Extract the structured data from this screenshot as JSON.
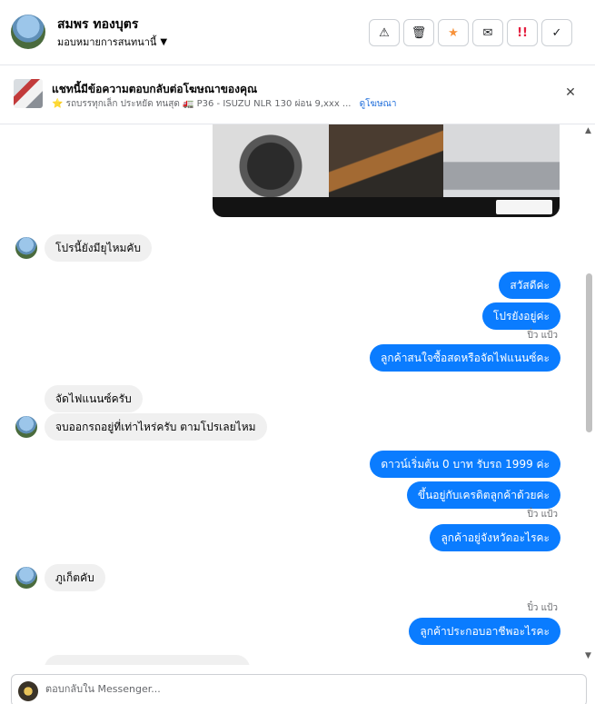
{
  "header": {
    "name": "สมพร ทองบุตร",
    "subtitle": "มอบหมายการสนทนานี้",
    "actions": [
      {
        "icon": "warning-icon",
        "glyph": "⚠"
      },
      {
        "icon": "trash-icon",
        "glyph": "🗑"
      },
      {
        "icon": "star-icon",
        "glyph": "★"
      },
      {
        "icon": "envelope-icon",
        "glyph": "✉"
      },
      {
        "icon": "urgent-icon",
        "glyph": "!!"
      },
      {
        "icon": "check-icon",
        "glyph": "✓"
      }
    ]
  },
  "ad_banner": {
    "title": "แชทนี้มีข้อความตอบกลับต่อโฆษณาของคุณ",
    "meta": "⭐ รถบรรทุกเล็ก ประหยัด ทนสุด 🚛 P36 - ISUZU NLR 130 ผ่อน 9,xxx ...",
    "link": "ดูโฆษณา",
    "close_glyph": "✕"
  },
  "messages": [
    {
      "side": "in",
      "text": "โปรนี้ยังมียุไหมคับ",
      "avatar": true
    },
    {
      "side": "out",
      "text": "สวัสดีค่ะ"
    },
    {
      "side": "out",
      "text": "โปรยังอยู่ค่ะ"
    },
    {
      "side": "status",
      "text": "ปิ๋ว แป้ว"
    },
    {
      "side": "out",
      "text": "ลูกค้าสนใจซื้อสดหรือจัดไฟแนนซ์คะ"
    },
    {
      "side": "in",
      "text": "จัดไฟแนนซ์ครับ",
      "avatar": false
    },
    {
      "side": "in",
      "text": "จบออกรถอยู่ที่เท่าไหร่ครับ ตามโปรเลยไหม",
      "avatar": true
    },
    {
      "side": "out",
      "text": "ดาวน์เริ่มต้น 0 บาท รับรถ 1999 ค่ะ"
    },
    {
      "side": "out",
      "text": "ขึ้นอยู่กับเครดิตลูกค้าด้วยค่ะ"
    },
    {
      "side": "status",
      "text": "ปิ๋ว แป้ว"
    },
    {
      "side": "out",
      "text": "ลูกค้าอยู่จังหวัดอะไรคะ"
    },
    {
      "side": "in",
      "text": "ภูเก็ตคับ",
      "avatar": true
    },
    {
      "side": "status",
      "text": "ปิ๋ว แป้ว"
    },
    {
      "side": "out",
      "text": "ลูกค้าประกอบอาชีพอะไรคะ"
    }
  ],
  "composer": {
    "placeholder": "ตอบกลับใน Messenger..."
  },
  "scrollbar": {
    "up_glyph": "▲",
    "down_glyph": "▼"
  }
}
